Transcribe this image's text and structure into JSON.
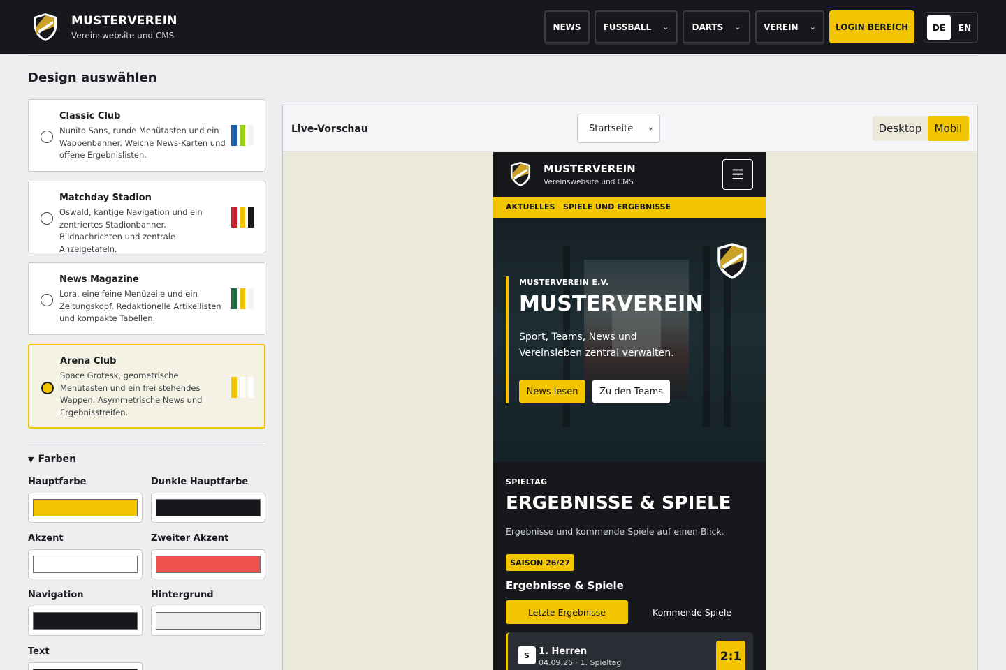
{
  "header": {
    "brand_title": "MUSTERVEREIN",
    "brand_subtitle": "Vereinswebsite und CMS",
    "nav": [
      {
        "label": "NEWS"
      },
      {
        "label": "FUSSBALL"
      },
      {
        "label": "DARTS"
      },
      {
        "label": "VEREIN"
      }
    ],
    "login_label": "LOGIN BEREICH",
    "lang": {
      "de": "DE",
      "en": "EN",
      "active": "DE"
    }
  },
  "design": {
    "section_title": "Design auswählen",
    "options": [
      {
        "name": "Classic Club",
        "desc": "Nunito Sans, runde Menütasten und ein Wappenbanner. Weiche News-Karten und offene Ergebnislisten.",
        "colors": [
          "#1a5ea8",
          "#9fd21a",
          "#ffffff"
        ],
        "selected": false
      },
      {
        "name": "Matchday Stadion",
        "desc": "Oswald, kantige Navigation und ein zentriertes Stadionbanner. Bildnachrichten und zentrale Anzeigetafeln.",
        "colors": [
          "#c41e2f",
          "#f2c500",
          "#16181c"
        ],
        "selected": false
      },
      {
        "name": "News Magazine",
        "desc": "Lora, eine feine Menüzeile und ein Zeitungskopf. Redaktionelle Artikellisten und kompakte Tabellen.",
        "colors": [
          "#1c6b3f",
          "#f2c500",
          "#ffffff"
        ],
        "selected": false
      },
      {
        "name": "Arena Club",
        "desc": "Space Grotesk, geometrische Menütasten und ein frei stehendes Wappen. Asymmetrische News und Ergebnisstreifen.",
        "colors": [
          "#f2c500",
          "#ffffff",
          "#ffffff"
        ],
        "selected": true
      }
    ]
  },
  "colors": {
    "heading": "Farben",
    "fields": [
      {
        "label": "Hauptfarbe",
        "value": "#f2c500"
      },
      {
        "label": "Dunkle Hauptfarbe",
        "value": "#16181c"
      },
      {
        "label": "Akzent",
        "value": "#ffffff"
      },
      {
        "label": "Zweiter Akzent",
        "value": "#ef5350"
      },
      {
        "label": "Navigation",
        "value": "#16181c"
      },
      {
        "label": "Hintergrund",
        "value": "#eceef0"
      },
      {
        "label": "Text",
        "value": "#16181c"
      }
    ]
  },
  "preview": {
    "title": "Live-Vorschau",
    "page_select": "Startseite",
    "view_desktop": "Desktop",
    "view_mobile": "Mobil",
    "active_view": "Mobil",
    "phone": {
      "brand_title": "MUSTERVEREIN",
      "brand_subtitle": "Vereinswebsite und CMS",
      "subnav": [
        "AKTUELLES",
        "SPIELE UND ERGEBNISSE"
      ],
      "hero_kicker": "MUSTERVEREIN E.V.",
      "hero_title": "MUSTERVEREIN",
      "hero_text": "Sport, Teams, News und Vereinsleben zentral verwalten.",
      "btn_news": "News lesen",
      "btn_teams": "Zu den Teams",
      "section_kicker": "SPIELTAG",
      "section_title": "ERGEBNISSE & SPIELE",
      "section_text": "Ergebnisse und kommende Spiele auf einen Blick.",
      "season_badge": "SAISON 26/27",
      "results_heading": "Ergebnisse & Spiele",
      "tab_last": "Letzte Ergebnisse",
      "tab_next": "Kommende Spiele",
      "match": {
        "badge": "S",
        "team": "1. Herren",
        "date": "04.09.26 · 1. Spieltag",
        "score": "2:1"
      }
    }
  }
}
